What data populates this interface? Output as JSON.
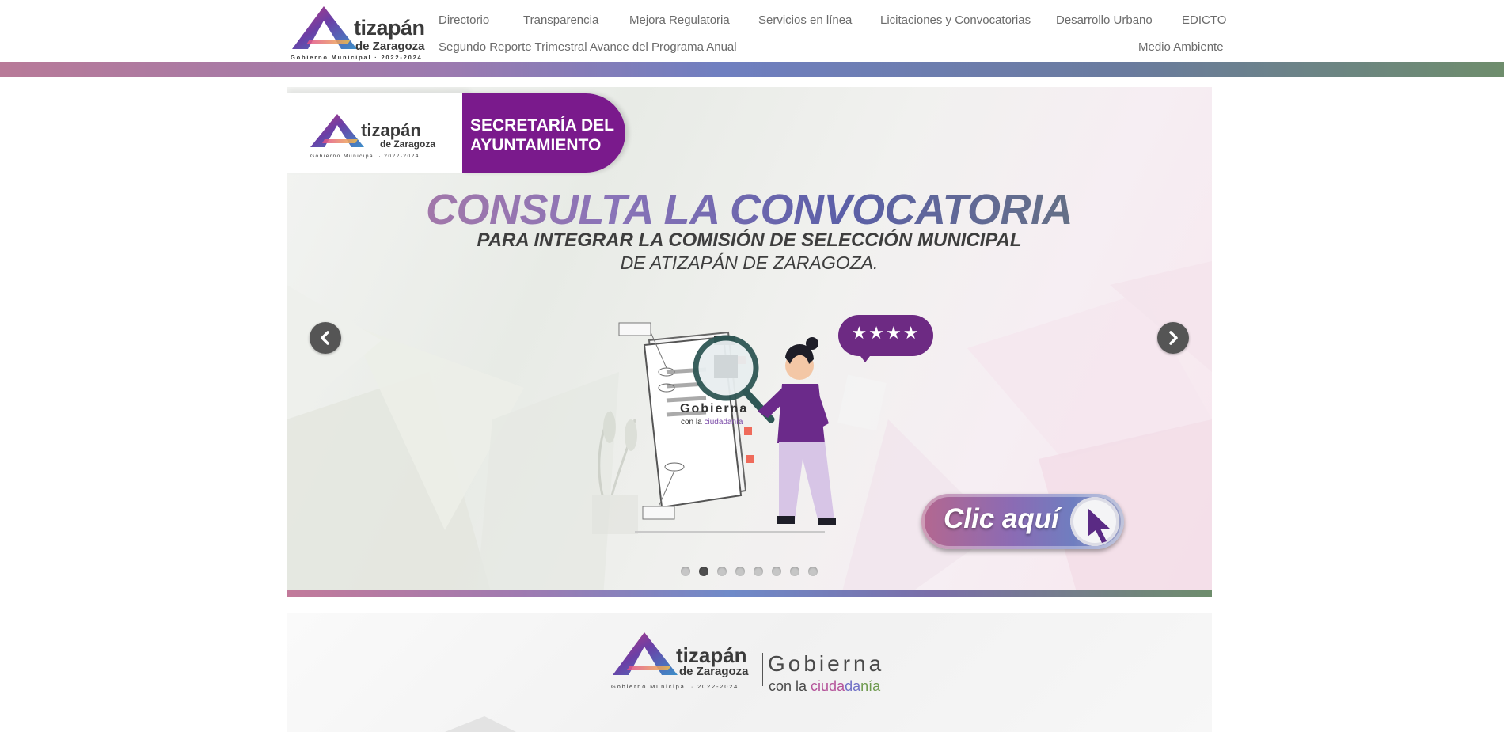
{
  "brand": {
    "name": "tizapán",
    "sub": "de Zaragoza",
    "caption": "Gobierno Municipal · 2022-2024"
  },
  "nav": {
    "row1": [
      "Directorio",
      "Transparencia",
      "Mejora Regulatoria",
      "Servicios en línea",
      "Licitaciones y Convocatorias",
      "Desarrollo Urbano",
      "EDICTO"
    ],
    "row2_left": "Segundo Reporte Trimestral Avance del Programa Anual",
    "row2_right": "Medio Ambiente"
  },
  "slide": {
    "secretaria": "SECRETARÍA DEL AYUNTAMIENTO",
    "headline": "CONSULTA LA CONVOCATORIA",
    "subline1": "PARA INTEGRAR LA COMISIÓN DE SELECCIÓN MUNICIPAL",
    "subline2": "DE ATIZAPÁN DE ZARAGOZA.",
    "rating": "★★★★",
    "doc_title": "Gobierna",
    "doc_sub_prefix": "con la ",
    "doc_sub_word": "ciudadanía",
    "cta": "Clic aquí",
    "dots_total": 8,
    "active_dot": 2
  },
  "banner2": {
    "gobierna": "Gobierna",
    "con_la": "con la ",
    "ciudadania_parts": [
      "ciuda",
      "da",
      "nía"
    ]
  },
  "colors": {
    "purple": "#7a1a8c",
    "nav_text": "#6b6b6b",
    "arrow_bg": "#555555"
  },
  "icons": {
    "prev": "chevron-left-icon",
    "next": "chevron-right-icon",
    "cursor": "cursor-arrow-icon"
  }
}
